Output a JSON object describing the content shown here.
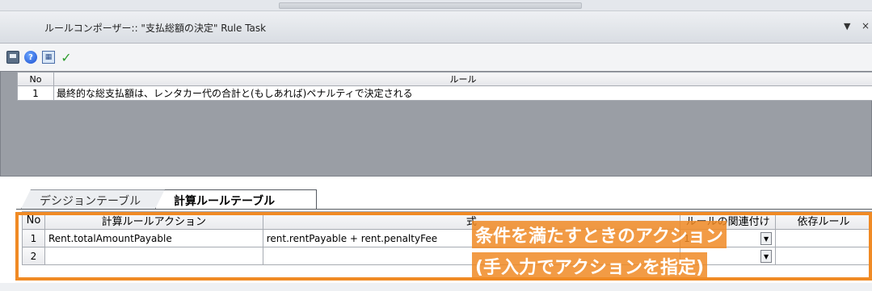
{
  "window": {
    "title": "ルールコンポーザー:: \"支払総額の決定\" Rule Task",
    "menu_arrow": "▼",
    "close": "×"
  },
  "toolbar": {
    "icons": [
      "save-icon",
      "help-icon",
      "table-icon",
      "check-icon"
    ]
  },
  "rule_table": {
    "columns": [
      "No",
      "ルール"
    ],
    "rows": [
      {
        "no": "1",
        "rule": "最終的な総支払額は、レンタカー代の合計と(もしあれば)ペナルティで決定される"
      }
    ]
  },
  "tabs": [
    {
      "label": "デシジョンテーブル",
      "active": false
    },
    {
      "label": "計算ルールテーブル",
      "active": true
    }
  ],
  "calc_table": {
    "columns": [
      "No",
      "計算ルールアクション",
      "式",
      "ルールの関連付け",
      "依存ルール"
    ],
    "rows": [
      {
        "no": "1",
        "action": "Rent.totalAmountPayable",
        "expression": "rent.rentPayable + rent.penaltyFee",
        "association": "1",
        "dependency": ""
      },
      {
        "no": "2",
        "action": "",
        "expression": "",
        "association": "",
        "dependency": ""
      }
    ]
  },
  "annotation": {
    "line1": "条件を満たすときのアクション",
    "line2": "(手入力でアクションを指定)",
    "color": "#f08a24"
  }
}
